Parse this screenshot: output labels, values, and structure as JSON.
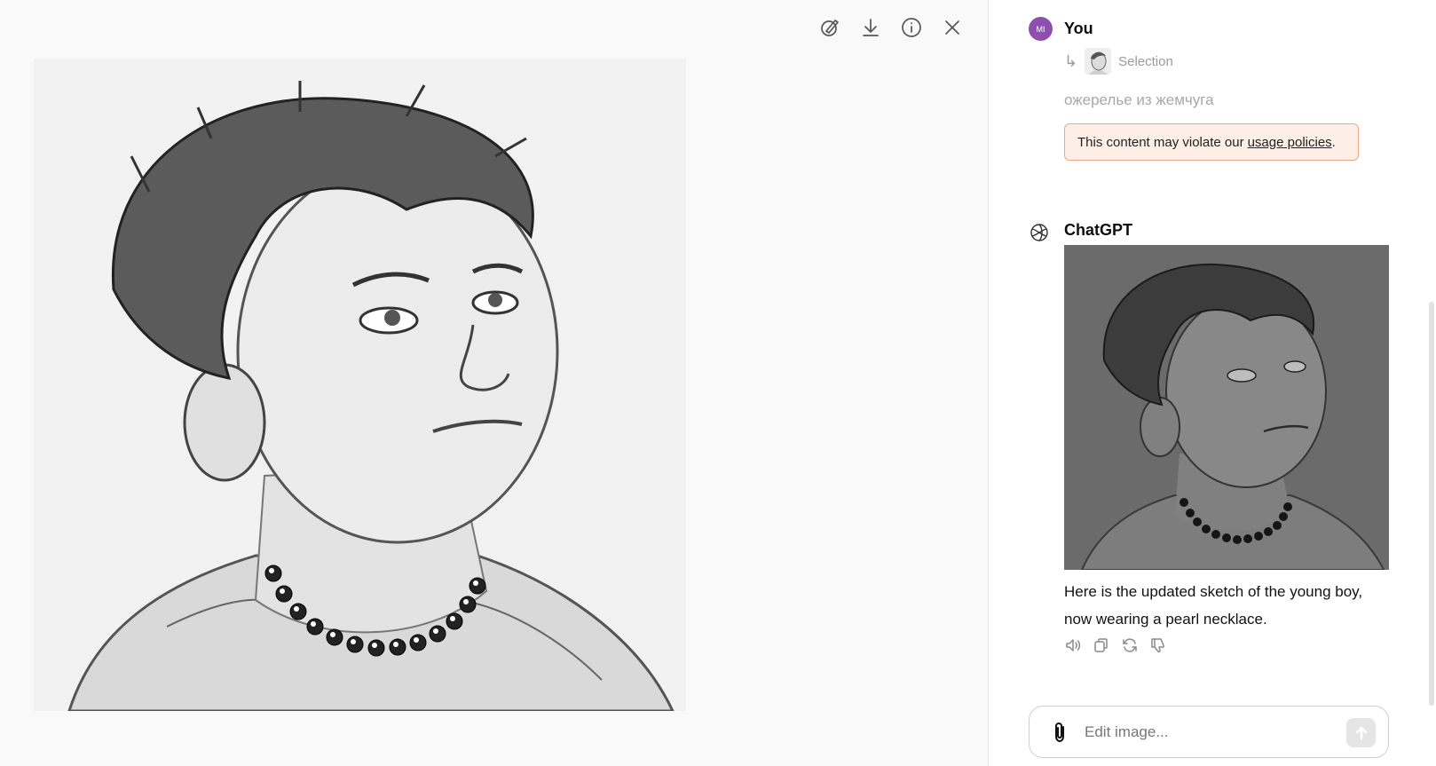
{
  "toolbar": {
    "icons": [
      "edit-selection-icon",
      "download-icon",
      "info-icon",
      "close-icon"
    ]
  },
  "user_message": {
    "avatar_initials": "MI",
    "avatar_color": "#8e4fb0",
    "author": "You",
    "selection_label": "Selection",
    "text": "ожерелье из жемчуга",
    "warning_text": "This content may violate our",
    "warning_link": "usage policies",
    "warning_end": "."
  },
  "bot_message": {
    "author": "ChatGPT",
    "text": "Here is the updated sketch of the young boy, now wearing a pearl necklace.",
    "actions": [
      "read-aloud-icon",
      "copy-icon",
      "regenerate-icon",
      "thumbs-down-icon"
    ]
  },
  "composer": {
    "placeholder": "Edit image...",
    "value": ""
  },
  "colors": {
    "warning_bg": "#fdefe6",
    "warning_border": "#eea58a"
  }
}
